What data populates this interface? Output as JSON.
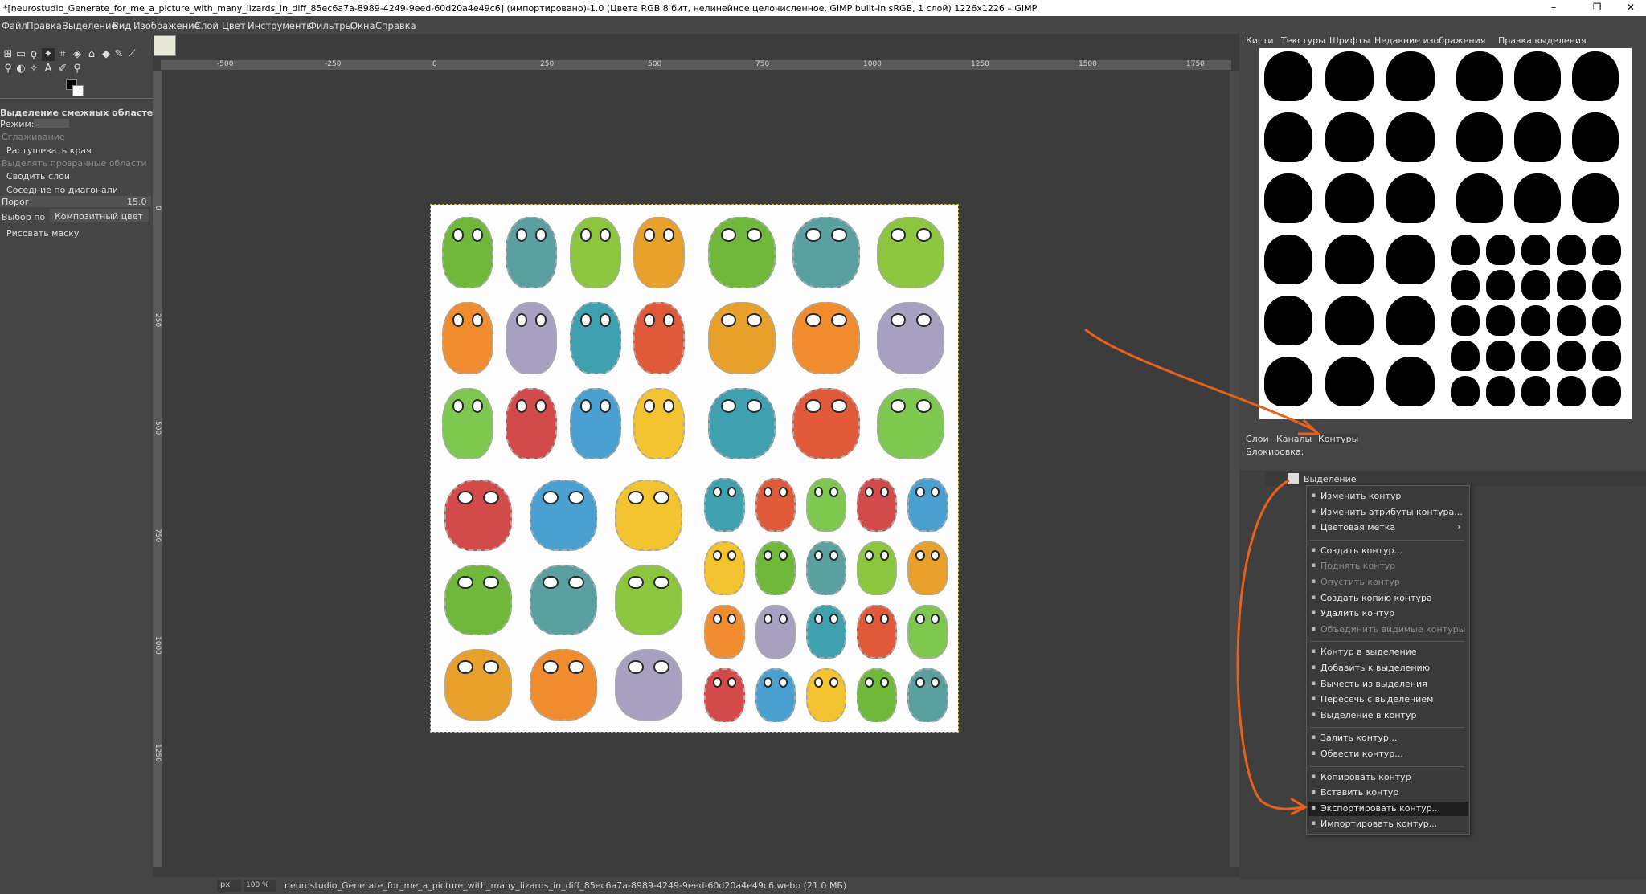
{
  "window": {
    "title": "*[neurostudio_Generate_for_me_a_picture_with_many_lizards_in_diff_85ec6a7a-8989-4249-9eed-60d20a4e49c6] (импортировано)-1.0 (Цвета RGB 8 бит, нелинейное целочисленное, GIMP built-in sRGB, 1 слой) 1226x1226 – GIMP",
    "minimize": "–",
    "maximize": "❐",
    "close": "✕"
  },
  "menu": [
    "Файл",
    "Правка",
    "Выделение",
    "Вид",
    "Изображение",
    "Слой",
    "Цвет",
    "Инструменты",
    "Фильтры",
    "Окна",
    "Справка"
  ],
  "tool_options": {
    "title": "Выделение смежных областей",
    "mode_label": "Режим:",
    "antialias": "Сглаживание",
    "feather": "Растушевать края",
    "select_transparent": "Выделять прозрачные области",
    "sample_merged": "Сводить слои",
    "diagonal": "Соседние по диагонали",
    "threshold_label": "Порог",
    "threshold_value": "15.0",
    "select_by_label": "Выбор по",
    "select_by_value": "Композитный цвет",
    "draw_mask": "Рисовать маску"
  },
  "ruler": {
    "h": [
      "-500",
      "-250",
      "0",
      "250",
      "500",
      "750",
      "1000",
      "1250",
      "1500",
      "1750"
    ],
    "v": [
      "0",
      "250",
      "500",
      "750",
      "1000",
      "1250"
    ]
  },
  "status": {
    "unit": "px",
    "zoom": "100 %",
    "file": "neurostudio_Generate_for_me_a_picture_with_many_lizards_in_diff_85ec6a7a-8989-4249-9eed-60d20a4e49c6.webp (21.0 МБ)"
  },
  "dock_tabs_top": [
    "Кисти",
    "Текстуры",
    "Шрифты",
    "Недавние изображения",
    "Правка выделения"
  ],
  "dock_tabs_bottom": [
    "Слои",
    "Каналы",
    "Контуры"
  ],
  "lock_label": "Блокировка:",
  "path_name": "Выделение",
  "context_menu": {
    "group1": [
      {
        "label": "Изменить контур",
        "enabled": true
      },
      {
        "label": "Изменить атрибуты контура...",
        "enabled": true
      },
      {
        "label": "Цветовая метка",
        "enabled": true
      }
    ],
    "group2": [
      {
        "label": "Создать контур...",
        "enabled": true
      },
      {
        "label": "Поднять контур",
        "enabled": false
      },
      {
        "label": "Опустить контур",
        "enabled": false
      },
      {
        "label": "Создать копию контура",
        "enabled": true
      },
      {
        "label": "Удалить контур",
        "enabled": true
      },
      {
        "label": "Объединить видимые контуры",
        "enabled": false
      }
    ],
    "group3": [
      {
        "label": "Контур в выделение",
        "enabled": true
      },
      {
        "label": "Добавить к выделению",
        "enabled": true
      },
      {
        "label": "Вычесть из выделения",
        "enabled": true
      },
      {
        "label": "Пересечь с выделением",
        "enabled": true
      },
      {
        "label": "Выделение в контур",
        "enabled": true
      }
    ],
    "group4": [
      {
        "label": "Залить контур...",
        "enabled": true
      },
      {
        "label": "Обвести контур...",
        "enabled": true
      }
    ],
    "group5": [
      {
        "label": "Копировать контур",
        "enabled": true
      },
      {
        "label": "Вставить контур",
        "enabled": true
      },
      {
        "label": "Экспортировать контур...",
        "enabled": true,
        "highlighted": true
      },
      {
        "label": "Импортировать контур...",
        "enabled": true
      }
    ],
    "submenu_arrow": "›"
  },
  "colors": {
    "accent_arrow": "#e8601c",
    "highlight": "#1e1e1e"
  }
}
